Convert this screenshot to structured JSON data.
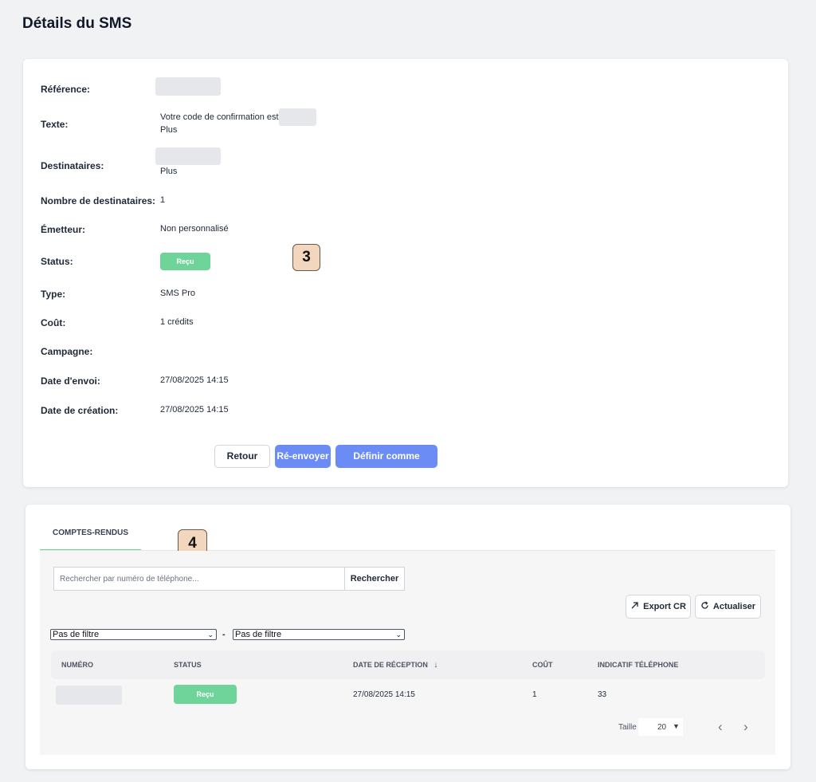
{
  "page": {
    "title": "Détails du SMS"
  },
  "details": {
    "reference_label": "Référence:",
    "text_label": "Texte:",
    "text_value": "Votre code de confirmation est",
    "text_more": "Plus",
    "recipients_label": "Destinataires:",
    "recipients_more": "Plus",
    "recipient_count_label": "Nombre de destinataires:",
    "recipient_count_value": "1",
    "sender_label": "Émetteur:",
    "sender_value": "Non personnalisé",
    "status_label": "Status:",
    "status_value": "Reçu",
    "type_label": "Type:",
    "type_value": "SMS Pro",
    "cost_label": "Coût:",
    "cost_value": "1 crédits",
    "campaign_label": "Campagne:",
    "campaign_value": "",
    "send_date_label": "Date d'envoi:",
    "send_date_value": "27/08/2025 14:15",
    "created_date_label": "Date de création:",
    "created_date_value": "27/08/2025 14:15"
  },
  "actions": {
    "back": "Retour",
    "resend": "Ré-envoyer",
    "set_template": "Définir comme modèle"
  },
  "markers": {
    "m3": "3",
    "m4": "4"
  },
  "reports": {
    "tab_label": "COMPTES-RENDUS",
    "search_placeholder": "Rechercher par numéro de téléphone...",
    "search_button": "Rechercher",
    "export_button": "Export CR",
    "refresh_button": "Actualiser",
    "filter1_selected": "Pas de filtre",
    "filter2_selected": "Pas de filtre",
    "filter_separator": "-",
    "columns": {
      "number": "NUMÉRO",
      "status": "STATUS",
      "received_date": "DATE DE RÉCEPTION",
      "cost": "COÛT",
      "country_code": "INDICATIF TÉLÉPHONE"
    },
    "rows": [
      {
        "status": "Reçu",
        "received_date": "27/08/2025 14:15",
        "cost": "1",
        "country_code": "33"
      }
    ],
    "pagination": {
      "size_label": "Taille",
      "size_value": "20"
    }
  },
  "colors": {
    "accent_blue": "#6b8cf5",
    "status_green": "#6fd49a",
    "marker_bg": "#f2d6be"
  }
}
